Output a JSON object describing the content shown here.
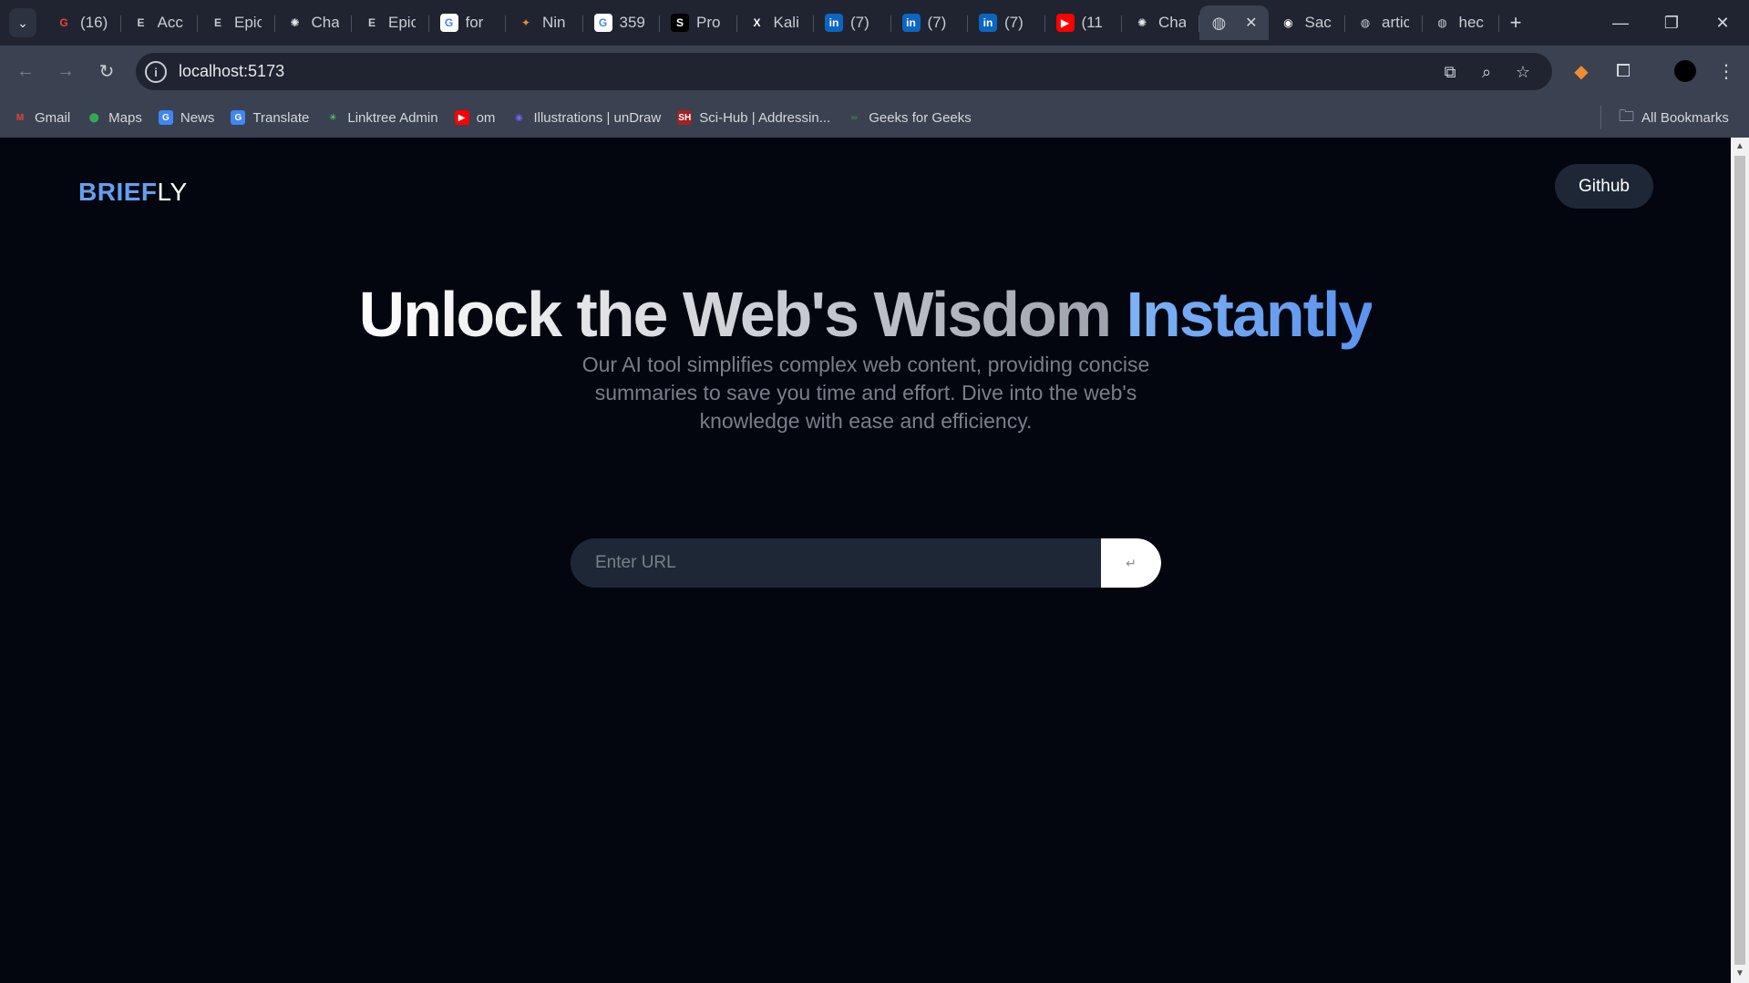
{
  "browser": {
    "tab_search_icon": "chevron-down-icon",
    "tabs": [
      {
        "title": "(16)",
        "icon": "G",
        "color": "#ea4335",
        "bg": "transparent"
      },
      {
        "title": "Acc",
        "icon": "E",
        "color": "#c9ccd2",
        "bg": "transparent"
      },
      {
        "title": "Epic",
        "icon": "E",
        "color": "#c9ccd2",
        "bg": "transparent"
      },
      {
        "title": "Cha",
        "icon": "✺",
        "color": "#e6e8ec",
        "bg": "transparent"
      },
      {
        "title": "Epic",
        "icon": "E",
        "color": "#c9ccd2",
        "bg": "transparent"
      },
      {
        "title": "for",
        "icon": "G",
        "color": "#4285f4",
        "bg": "#ffffff"
      },
      {
        "title": "Nin",
        "icon": "✦",
        "color": "#f28b30",
        "bg": "transparent"
      },
      {
        "title": "359",
        "icon": "G",
        "color": "#4285f4",
        "bg": "#ffffff"
      },
      {
        "title": "Pro",
        "icon": "S",
        "color": "#ffffff",
        "bg": "#000000"
      },
      {
        "title": "Kali",
        "icon": "X",
        "color": "#ffffff",
        "bg": "transparent"
      },
      {
        "title": "(7)",
        "icon": "in",
        "color": "#ffffff",
        "bg": "#0a66c2"
      },
      {
        "title": "(7)",
        "icon": "in",
        "color": "#ffffff",
        "bg": "#0a66c2"
      },
      {
        "title": "(7)",
        "icon": "in",
        "color": "#ffffff",
        "bg": "#0a66c2"
      },
      {
        "title": "(11",
        "icon": "▶",
        "color": "#ffffff",
        "bg": "#ff0000"
      },
      {
        "title": "Cha",
        "icon": "✺",
        "color": "#e6e8ec",
        "bg": "transparent"
      }
    ],
    "active_tab_icon": "globe-icon",
    "tabs_after": [
      {
        "title": "Sac",
        "icon": "◉",
        "color": "#ffffff",
        "bg": "transparent"
      },
      {
        "title": "artic",
        "icon": "◍",
        "color": "#c9ccd2",
        "bg": "transparent"
      },
      {
        "title": "hec",
        "icon": "◍",
        "color": "#c9ccd2",
        "bg": "transparent"
      }
    ],
    "url": "localhost:5173",
    "bookmarks": [
      {
        "label": "Gmail",
        "icon": "M",
        "color": "#ea4335",
        "bg": "transparent"
      },
      {
        "label": "Maps",
        "icon": "⬤",
        "color": "#34a853",
        "bg": "transparent"
      },
      {
        "label": "News",
        "icon": "G",
        "color": "#ffffff",
        "bg": "#4285f4"
      },
      {
        "label": "Translate",
        "icon": "G",
        "color": "#ffffff",
        "bg": "#4285f4"
      },
      {
        "label": "Linktree Admin",
        "icon": "✳",
        "color": "#43e660",
        "bg": "transparent"
      },
      {
        "label": "om",
        "icon": "▶",
        "color": "#ffffff",
        "bg": "#ff0000"
      },
      {
        "label": "Illustrations | unDraw",
        "icon": "◉",
        "color": "#6c63ff",
        "bg": "transparent"
      },
      {
        "label": "Sci-Hub | Addressin...",
        "icon": "SH",
        "color": "#ffffff",
        "bg": "#a32222"
      },
      {
        "label": "Geeks for Geeks",
        "icon": "∞",
        "color": "#2f8d46",
        "bg": "transparent"
      }
    ],
    "all_bookmarks": "All Bookmarks"
  },
  "app": {
    "logo_part1": "BRIEF",
    "logo_part2": "LY",
    "github_label": "Github",
    "hero_main": "Unlock the Web's Wisdom ",
    "hero_accent": "Instantly",
    "subtitle": "Our AI tool simplifies complex web content, providing concise summaries to save you time and effort. Dive into the web's knowledge with ease and efficiency.",
    "url_placeholder": "Enter URL",
    "submit_icon": "enter-icon",
    "colors": {
      "background": "#03060f",
      "accent": "#62a0f0",
      "button_bg": "#1e2735"
    }
  }
}
